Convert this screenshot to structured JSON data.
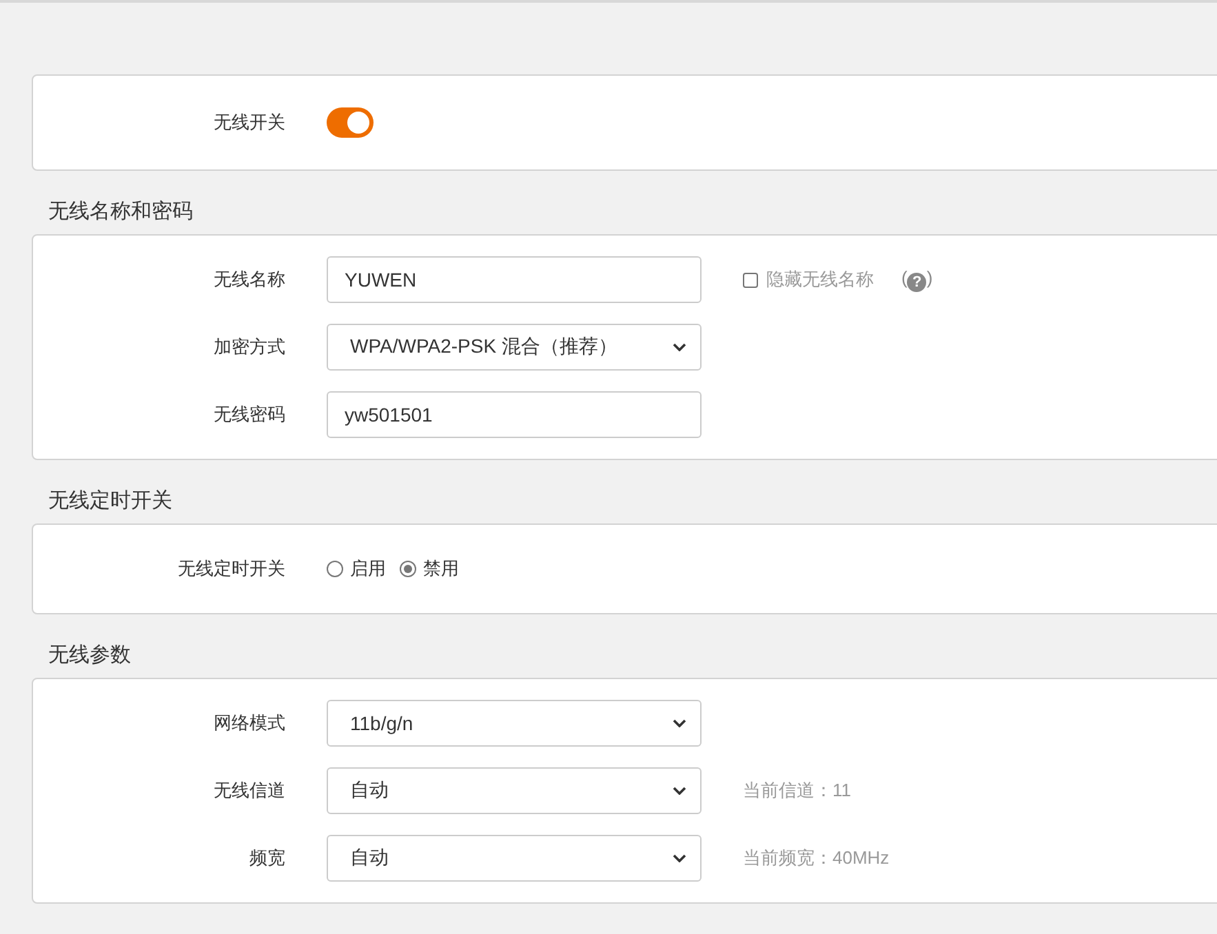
{
  "sections": [
    {
      "rows": [
        {
          "kind": "toggle",
          "label": "无线开关",
          "on": true
        }
      ]
    },
    {
      "title": "无线名称和密码",
      "rows": [
        {
          "kind": "text",
          "label": "无线名称",
          "value": "YUWEN",
          "extra": {
            "kind": "checkbox",
            "label": "隐藏无线名称",
            "checked": false,
            "help": "(?)"
          }
        },
        {
          "kind": "select",
          "label": "加密方式",
          "value": "WPA/WPA2-PSK 混合（推荐）"
        },
        {
          "kind": "text",
          "label": "无线密码",
          "value": "yw501501"
        }
      ]
    },
    {
      "title": "无线定时开关",
      "rows": [
        {
          "kind": "radio",
          "label": "无线定时开关",
          "options": [
            {
              "label": "启用",
              "selected": false
            },
            {
              "label": "禁用",
              "selected": true
            }
          ]
        }
      ]
    },
    {
      "title": "无线参数",
      "rows": [
        {
          "kind": "select",
          "label": "网络模式",
          "value": "11b/g/n"
        },
        {
          "kind": "select",
          "label": "无线信道",
          "value": "自动",
          "extra": {
            "kind": "note",
            "text": "当前信道：11"
          }
        },
        {
          "kind": "select",
          "label": "频宽",
          "value": "自动",
          "extra": {
            "kind": "note",
            "text": "当前频宽：40MHz"
          }
        }
      ]
    }
  ]
}
